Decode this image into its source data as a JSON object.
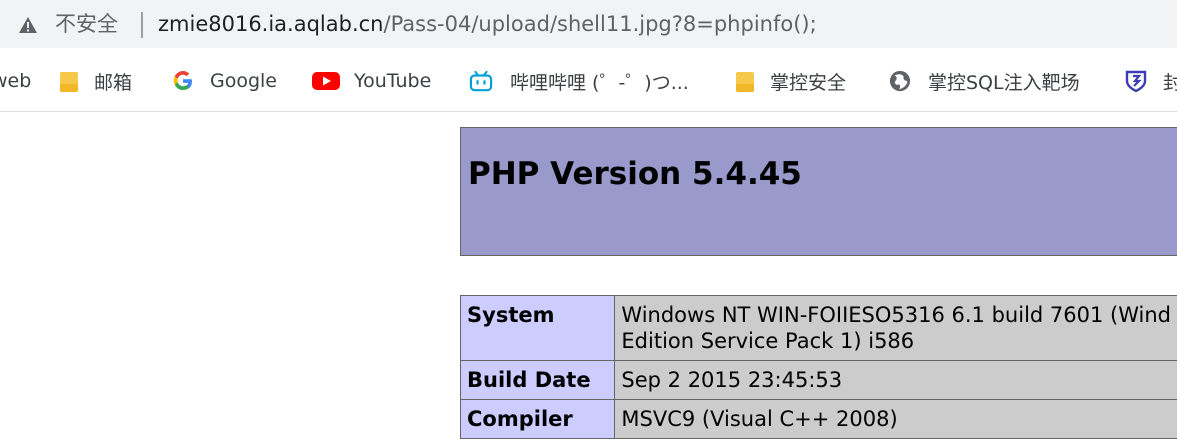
{
  "address_bar": {
    "security_label": "不安全",
    "url_host": "zmie8016.ia.aqlab.cn",
    "url_path": "/Pass-04/upload/shell11.jpg?8=phpinfo();"
  },
  "bookmarks": [
    {
      "label": "web",
      "icon": "none"
    },
    {
      "label": "邮箱",
      "icon": "folder-icon"
    },
    {
      "label": "Google",
      "icon": "google-icon"
    },
    {
      "label": "YouTube",
      "icon": "youtube-icon"
    },
    {
      "label": "哔哩哔哩 (゜-゜)つ...",
      "icon": "bilibili-icon"
    },
    {
      "label": "掌控安全",
      "icon": "folder-icon"
    },
    {
      "label": "掌控SQL注入靶场",
      "icon": "globe-icon"
    },
    {
      "label": "封",
      "icon": "shield-icon"
    }
  ],
  "php": {
    "title": "PHP Version 5.4.45",
    "rows": [
      {
        "key": "System",
        "value_line1": "Windows NT WIN-FOIIESO5316 6.1 build 7601 (Wind",
        "value_line2": "Edition Service Pack 1) i586"
      },
      {
        "key": "Build Date",
        "value_line1": "Sep 2 2015 23:45:53"
      },
      {
        "key": "Compiler",
        "value_line1": "MSVC9 (Visual C++ 2008)"
      }
    ]
  },
  "colors": {
    "header_bg": "#9999cc",
    "key_bg": "#ccccff",
    "value_bg": "#cccccc",
    "omnibox_bg": "#f1f3f4"
  }
}
